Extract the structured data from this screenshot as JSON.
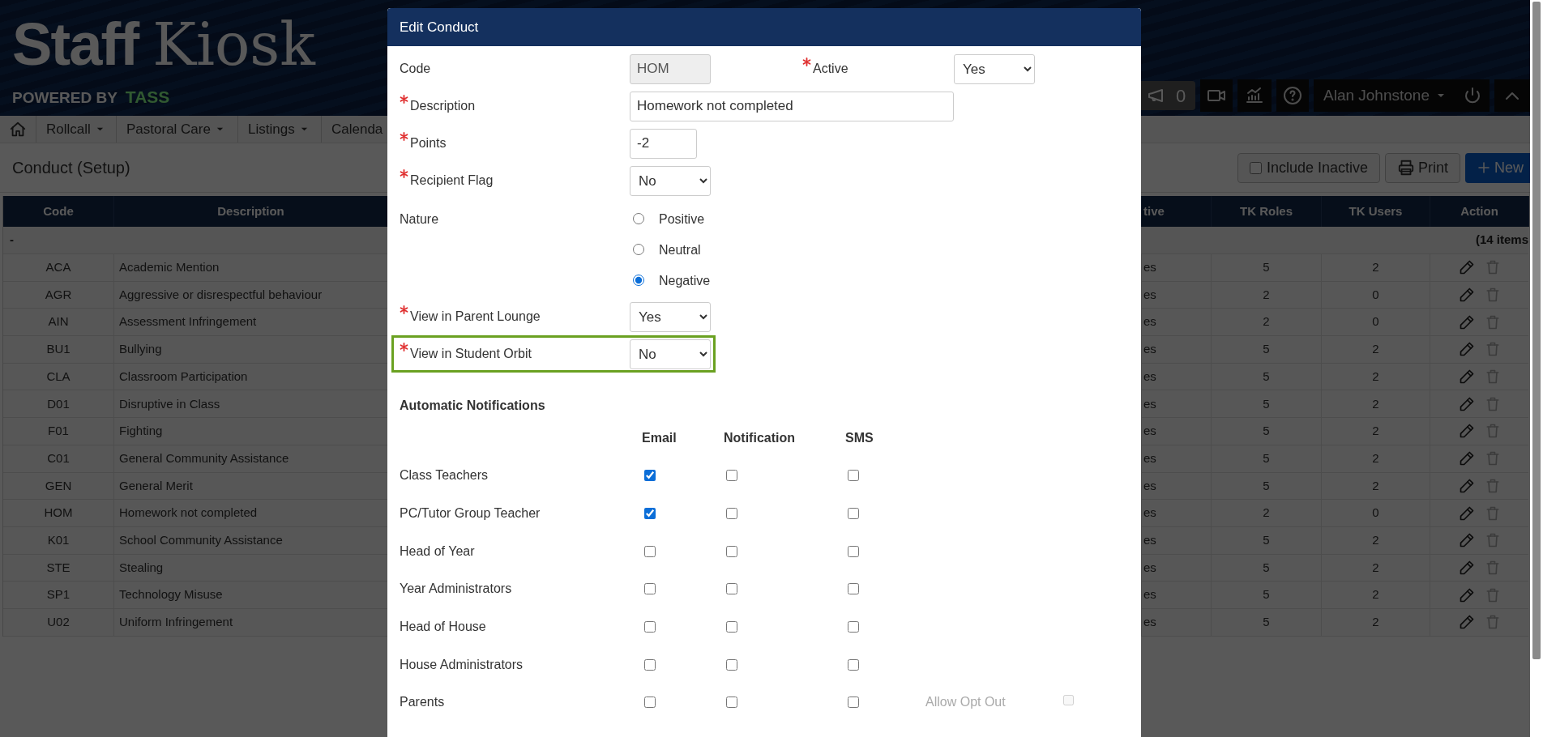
{
  "header": {
    "logo_title_1": "Staff",
    "logo_title_2": "Kiosk",
    "logo_powered_by": "POWERED BY",
    "logo_brand": "TASS",
    "announcements_count": "0",
    "user_name": "Alan Johnstone"
  },
  "nav": [
    {
      "label": "Rollcall",
      "dropdown": true
    },
    {
      "label": "Pastoral Care",
      "dropdown": true
    },
    {
      "label": "Listings",
      "dropdown": true
    },
    {
      "label": "Calenda"
    }
  ],
  "page": {
    "title": "Conduct (Setup)",
    "include_inactive": {
      "label": "Include Inactive",
      "checked": false
    },
    "print_label": "Print",
    "new_label": "New"
  },
  "table": {
    "columns": [
      "Code",
      "Description",
      "tive",
      "TK Roles",
      "TK Users",
      "Action"
    ],
    "group": {
      "label": "-",
      "count": "(14 items"
    },
    "rows": [
      {
        "code": "ACA",
        "description": "Academic Mention",
        "column_3": "es",
        "tk_roles": "5",
        "tk_users": "2"
      },
      {
        "code": "AGR",
        "description": "Aggressive or disrespectful behaviour",
        "column_3": "es",
        "tk_roles": "2",
        "tk_users": "0"
      },
      {
        "code": "AIN",
        "description": "Assessment Infringement",
        "column_3": "es",
        "tk_roles": "2",
        "tk_users": "0"
      },
      {
        "code": "BU1",
        "description": "Bullying",
        "column_3": "es",
        "tk_roles": "5",
        "tk_users": "2"
      },
      {
        "code": "CLA",
        "description": "Classroom Participation",
        "column_3": "es",
        "tk_roles": "5",
        "tk_users": "2"
      },
      {
        "code": "D01",
        "description": "Disruptive in Class",
        "column_3": "es",
        "tk_roles": "5",
        "tk_users": "2"
      },
      {
        "code": "F01",
        "description": "Fighting",
        "column_3": "es",
        "tk_roles": "5",
        "tk_users": "2"
      },
      {
        "code": "C01",
        "description": "General Community Assistance",
        "column_3": "es",
        "tk_roles": "5",
        "tk_users": "2"
      },
      {
        "code": "GEN",
        "description": "General Merit",
        "column_3": "es",
        "tk_roles": "5",
        "tk_users": "2"
      },
      {
        "code": "HOM",
        "description": "Homework not completed",
        "column_3": "es",
        "tk_roles": "2",
        "tk_users": "0"
      },
      {
        "code": "K01",
        "description": "School Community Assistance",
        "column_3": "es",
        "tk_roles": "5",
        "tk_users": "2"
      },
      {
        "code": "STE",
        "description": "Stealing",
        "column_3": "es",
        "tk_roles": "5",
        "tk_users": "2"
      },
      {
        "code": "SP1",
        "description": "Technology Misuse",
        "column_3": "es",
        "tk_roles": "5",
        "tk_users": "2"
      },
      {
        "code": "U02",
        "description": "Uniform Infringement",
        "column_3": "es",
        "tk_roles": "5",
        "tk_users": "2"
      }
    ]
  },
  "modal": {
    "title": "Edit Conduct",
    "fields": [
      {
        "kind": "readonly",
        "label": "Code",
        "required": false,
        "highlighted": false,
        "value": "HOM",
        "extra": {
          "label": "Active",
          "required": true,
          "value": "Yes"
        }
      },
      {
        "kind": "text",
        "label": "Description",
        "required": true,
        "highlighted": false,
        "value": "Homework not completed"
      },
      {
        "kind": "number",
        "label": "Points",
        "required": true,
        "highlighted": false,
        "value": "-2"
      },
      {
        "kind": "select",
        "label": "Recipient Flag",
        "required": true,
        "highlighted": false,
        "value": "No"
      },
      {
        "kind": "radio",
        "label": "Nature",
        "required": false,
        "highlighted": false,
        "options": [
          {
            "label": "Positive",
            "selected": false
          },
          {
            "label": "Neutral",
            "selected": false
          },
          {
            "label": "Negative",
            "selected": true
          }
        ]
      },
      {
        "kind": "select",
        "label": "View in Parent Lounge",
        "required": true,
        "highlighted": false,
        "value": "Yes"
      },
      {
        "kind": "select",
        "label": "View in Student Orbit",
        "required": true,
        "highlighted": true,
        "value": "No"
      }
    ],
    "notifications": {
      "title": "Automatic Notifications",
      "channels": [
        "Email",
        "Notification",
        "SMS"
      ],
      "rows": [
        {
          "label": "Class Teachers",
          "checks": [
            true,
            false,
            false
          ]
        },
        {
          "label": "PC/Tutor Group Teacher",
          "checks": [
            true,
            false,
            false
          ]
        },
        {
          "label": "Head of Year",
          "checks": [
            false,
            false,
            false
          ]
        },
        {
          "label": "Year Administrators",
          "checks": [
            false,
            false,
            false
          ]
        },
        {
          "label": "Head of House",
          "checks": [
            false,
            false,
            false
          ]
        },
        {
          "label": "House Administrators",
          "checks": [
            false,
            false,
            false
          ]
        },
        {
          "label": "Parents",
          "checks": [
            false,
            false,
            false
          ],
          "opt_out": {
            "label": "Allow Opt Out",
            "checked": false,
            "disabled": true
          }
        }
      ]
    }
  }
}
